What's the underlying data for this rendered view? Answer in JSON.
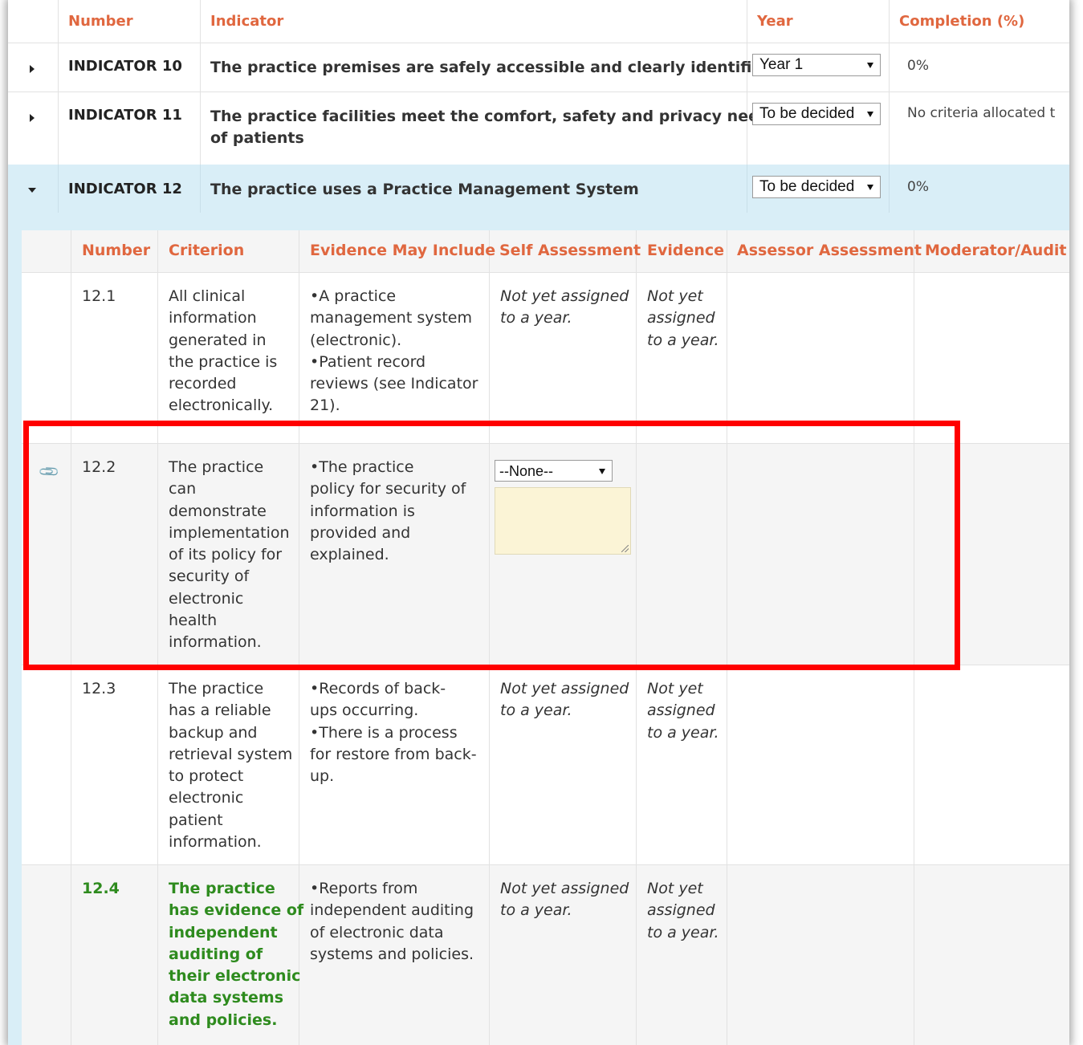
{
  "top_headers": {
    "number": "Number",
    "indicator": "Indicator",
    "year": "Year",
    "completion": "Completion (%)"
  },
  "indicators": [
    {
      "number": "INDICATOR 10",
      "title": "The practice premises are safely accessible and clearly identifiable",
      "year": "Year 1",
      "completion": "0%"
    },
    {
      "number": "INDICATOR 11",
      "title_line1": "The practice facilities meet the comfort, safety and privacy needs",
      "title_line2": "of patients",
      "year": "To be decided",
      "completion": "No criteria allocated t"
    },
    {
      "number": "INDICATOR 12",
      "title": "The practice uses a Practice Management System",
      "year": "To be decided",
      "completion": "0%"
    }
  ],
  "sub_headers": {
    "number": "Number",
    "criterion": "Criterion",
    "evidence_may_include": "Evidence May Include",
    "self_assessment": "Self Assessment",
    "evidence": "Evidence",
    "assessor_assessment": "Assessor Assessment",
    "moderator": "Moderator/Audit A"
  },
  "criteria": [
    {
      "number": "12.1",
      "criterion": [
        "All clinical",
        "information",
        "generated in",
        "the practice is",
        "recorded",
        "electronically."
      ],
      "evidence_may_include": [
        "A practice",
        "management system",
        "(electronic).",
        "Patient record",
        "reviews (see Indicator",
        "21)."
      ],
      "self_assessment": [
        "Not yet assigned",
        "to a year."
      ],
      "evidence": [
        "Not yet",
        "assigned",
        "to a year."
      ]
    },
    {
      "number": "12.2",
      "criterion": [
        "The practice",
        "can",
        "demonstrate",
        "implementation",
        "of its policy for",
        "security of",
        "electronic",
        "health",
        "information."
      ],
      "evidence_may_include": [
        "The practice",
        "policy for security of",
        "information is",
        "provided and",
        "explained."
      ],
      "self_assessment_select": "--None--",
      "self_assessment_textarea": ""
    },
    {
      "number": "12.3",
      "criterion": [
        "The practice",
        "has a reliable",
        "backup and",
        "retrieval system",
        "to protect",
        "electronic",
        "patient",
        "information."
      ],
      "evidence_may_include": [
        "Records of back-",
        "ups occurring.",
        "There is a process",
        "for restore from back-",
        "up."
      ],
      "self_assessment": [
        "Not yet assigned",
        "to a year."
      ],
      "evidence": [
        "Not yet",
        "assigned",
        "to a year."
      ]
    },
    {
      "number": "12.4",
      "criterion": [
        "The practice",
        "has evidence of",
        "independent",
        "auditing of",
        "their electronic",
        "data systems",
        "and policies."
      ],
      "evidence_may_include": [
        "Reports from",
        "independent auditing",
        "of electronic data",
        "systems and policies."
      ],
      "self_assessment": [
        "Not yet assigned",
        "to a year."
      ],
      "evidence": [
        "Not yet",
        "assigned",
        "to a year."
      ]
    }
  ],
  "colors": {
    "header_orange": "#e0673f",
    "expanded_row_bg": "#d9eef7",
    "criteria_green": "#2e8b1e",
    "highlight_box": "#ff0000",
    "textarea_bg": "#fbf4d6"
  },
  "icons": {
    "collapsed": "caret-right-icon",
    "expanded": "caret-down-icon",
    "attachment": "paperclip-icon"
  }
}
